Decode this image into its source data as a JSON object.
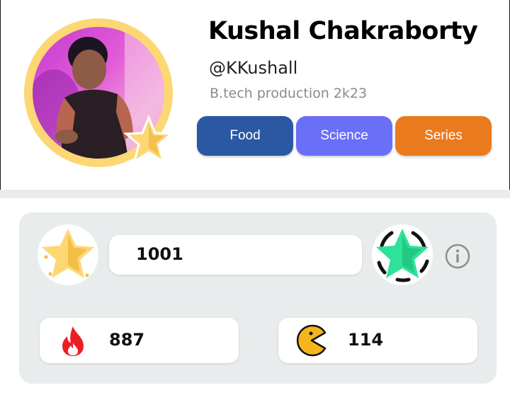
{
  "profile": {
    "name": "Kushal Chakraborty",
    "handle": "@KKushall",
    "bio": "B.tech production 2k23",
    "avatar_icon": "user-photo",
    "badge_icon": "star-icon"
  },
  "tags": [
    {
      "label": "Food",
      "color": "#2a58a3"
    },
    {
      "label": "Science",
      "color": "#6a6ff8"
    },
    {
      "label": "Series",
      "color": "#ea7a1e"
    }
  ],
  "stats": {
    "points": "1001",
    "points_icon": "gold-star-icon",
    "next_level_icon": "green-star-icon",
    "info_icon": "info-icon",
    "streak": "887",
    "streak_icon": "flame-icon",
    "games": "114",
    "games_icon": "pacman-icon"
  },
  "colors": {
    "gold": "#fcd774",
    "green_star": "#2ee29a",
    "flame": "#ee1d23",
    "pacman": "#f6b51c",
    "panel_bg": "#e9ecec"
  }
}
